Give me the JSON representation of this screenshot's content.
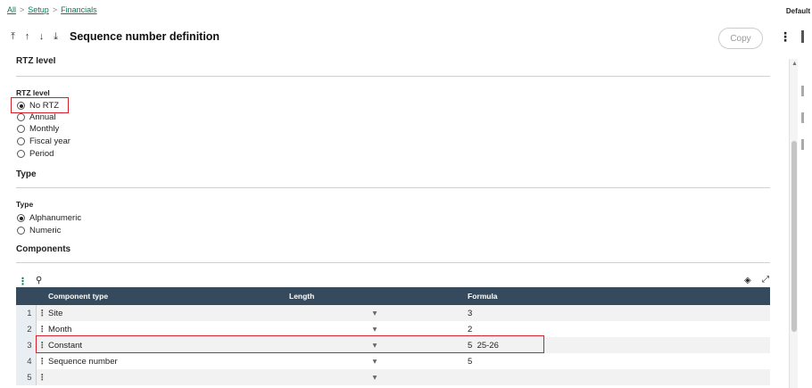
{
  "breadcrumb": {
    "items": [
      "All",
      "Setup",
      "Financials"
    ],
    "separator": ">"
  },
  "top_right_label": "Default",
  "header": {
    "title": "Sequence number definition",
    "copy_label": "Copy"
  },
  "sections": {
    "rtz": {
      "title": "RTZ level",
      "field_label": "RTZ level",
      "options": [
        "No RTZ",
        "Annual",
        "Monthly",
        "Fiscal year",
        "Period"
      ],
      "selected": "No RTZ"
    },
    "type": {
      "title": "Type",
      "field_label": "Type",
      "options": [
        "Alphanumeric",
        "Numeric"
      ],
      "selected": "Alphanumeric"
    },
    "components": {
      "title": "Components",
      "columns": [
        "Component type",
        "Length",
        "Formula"
      ],
      "rows": [
        {
          "num": "1",
          "type": "Site",
          "length": "3",
          "formula": ""
        },
        {
          "num": "2",
          "type": "Month",
          "length": "2",
          "formula": ""
        },
        {
          "num": "3",
          "type": "Constant",
          "length": "5",
          "formula": "25-26"
        },
        {
          "num": "4",
          "type": "Sequence number",
          "length": "5",
          "formula": ""
        },
        {
          "num": "5",
          "type": "",
          "length": "",
          "formula": ""
        }
      ]
    }
  },
  "icons": {
    "first": "⤒",
    "up": "↑",
    "down": "↓",
    "last": "⤓",
    "kebab": "⋮",
    "search": "⚲",
    "layers": "◈",
    "expand": "⤢",
    "dropdown": "▾"
  },
  "colors": {
    "header_bg": "#354a5c",
    "highlight": "#d81e2a",
    "link": "#0a7a5c"
  }
}
